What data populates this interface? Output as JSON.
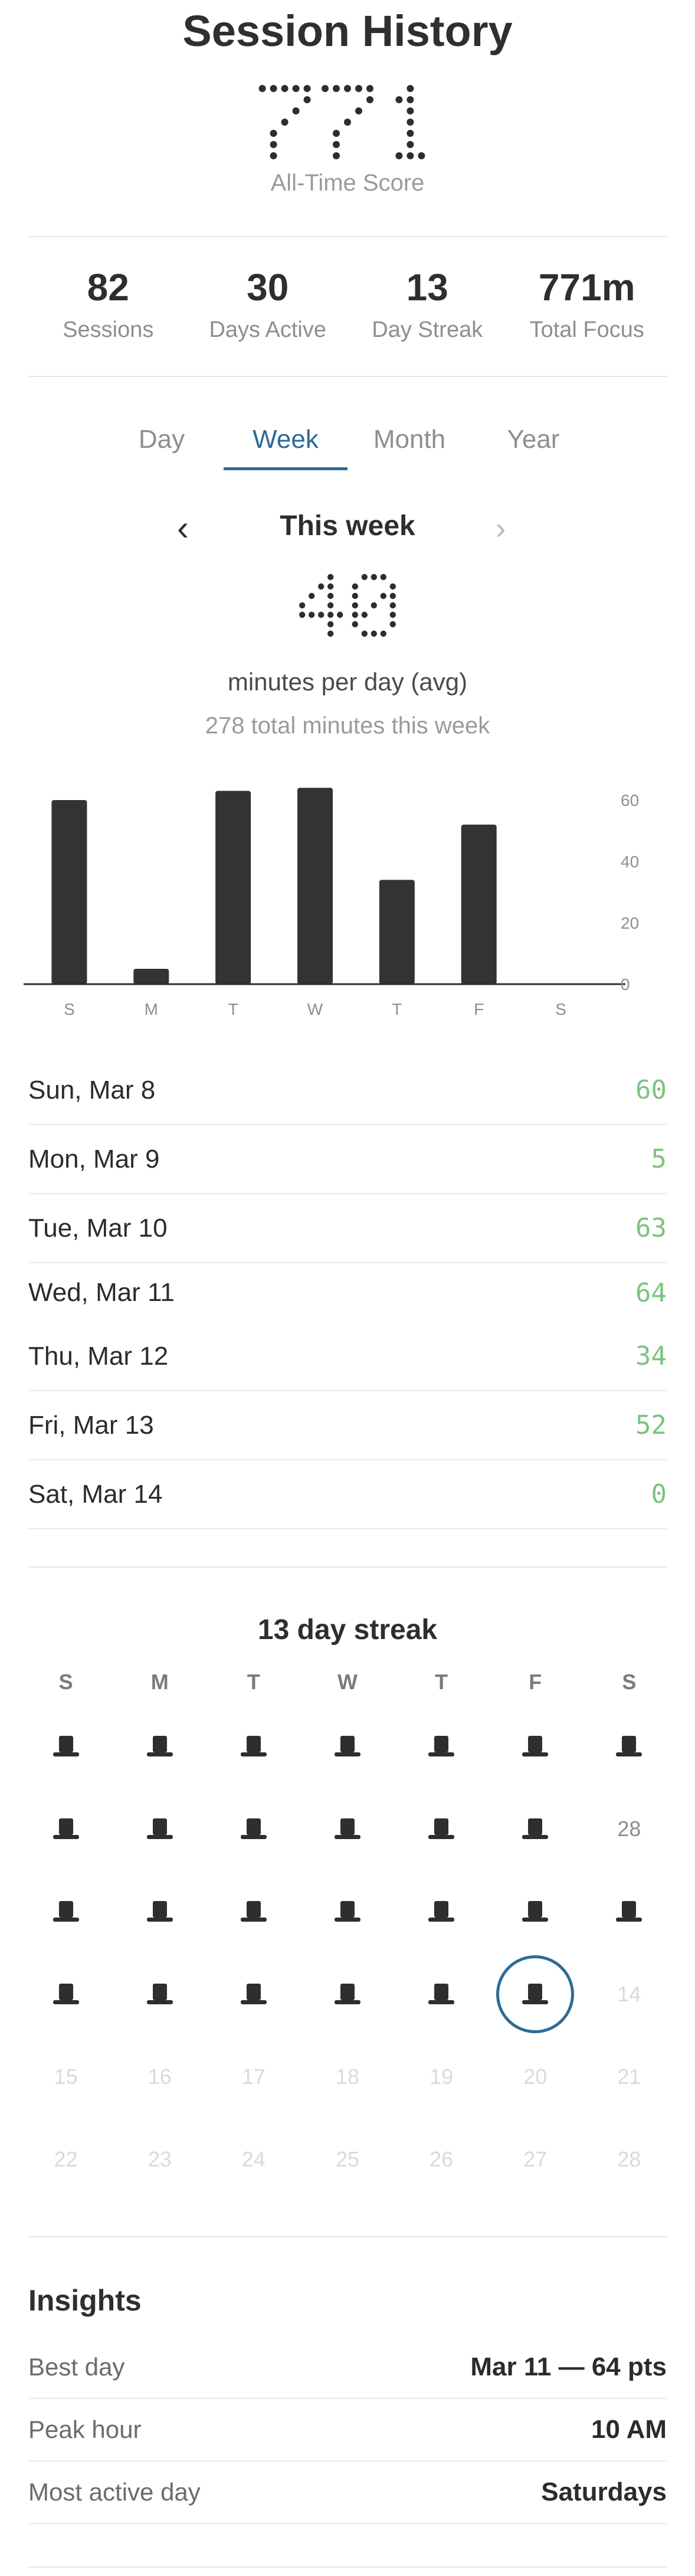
{
  "header": {
    "title": "Session History",
    "score": "771",
    "score_label": "All-Time Score"
  },
  "stats": [
    {
      "value": "82",
      "label": "Sessions"
    },
    {
      "value": "30",
      "label": "Days Active"
    },
    {
      "value": "13",
      "label": "Day Streak"
    },
    {
      "value": "771m",
      "label": "Total Focus"
    }
  ],
  "tabs": [
    {
      "label": "Day",
      "active": false
    },
    {
      "label": "Week",
      "active": true
    },
    {
      "label": "Month",
      "active": false
    },
    {
      "label": "Year",
      "active": false
    }
  ],
  "week_nav": {
    "prev_icon": "chevron-left-icon",
    "next_icon": "chevron-right-icon",
    "prev_glyph": "‹",
    "next_glyph": "›",
    "title": "This week"
  },
  "summary": {
    "avg": "40",
    "avg_label": "minutes per day (avg)",
    "total_label": "278 total minutes this week"
  },
  "chart_data": {
    "type": "bar",
    "categories": [
      "S",
      "M",
      "T",
      "W",
      "T",
      "F",
      "S"
    ],
    "values": [
      60,
      5,
      63,
      64,
      34,
      52,
      0
    ],
    "ylim": [
      0,
      65
    ],
    "yticks": [
      0,
      20,
      40,
      60
    ],
    "grid": false,
    "bar_color": "#333333"
  },
  "days": [
    {
      "name": "Sun, Mar 8",
      "value": "60"
    },
    {
      "name": "Mon, Mar 9",
      "value": "5"
    },
    {
      "name": "Tue, Mar 10",
      "value": "63"
    },
    {
      "name": "Wed, Mar 11",
      "value": "64"
    },
    {
      "name": "Thu, Mar 12",
      "value": "34"
    },
    {
      "name": "Fri, Mar 13",
      "value": "52"
    },
    {
      "name": "Sat, Mar 14",
      "value": "0"
    }
  ],
  "streak": {
    "title": "13 day streak",
    "weekdays": [
      "S",
      "M",
      "T",
      "W",
      "T",
      "F",
      "S"
    ],
    "icon": "top-hat-icon",
    "weeks": [
      [
        {
          "hat": true
        },
        {
          "hat": true
        },
        {
          "hat": true
        },
        {
          "hat": true
        },
        {
          "hat": true
        },
        {
          "hat": true
        },
        {
          "hat": true
        }
      ],
      [
        {
          "hat": true
        },
        {
          "hat": true
        },
        {
          "hat": true
        },
        {
          "hat": true
        },
        {
          "hat": true
        },
        {
          "hat": true
        },
        {
          "text": "28",
          "style": "prev"
        }
      ],
      [
        {
          "hat": true
        },
        {
          "hat": true
        },
        {
          "hat": true
        },
        {
          "hat": true
        },
        {
          "hat": true
        },
        {
          "hat": true
        },
        {
          "hat": true
        }
      ],
      [
        {
          "hat": true
        },
        {
          "hat": true
        },
        {
          "hat": true
        },
        {
          "hat": true
        },
        {
          "hat": true
        },
        {
          "hat": true,
          "today": true
        },
        {
          "text": "14",
          "style": "future"
        }
      ],
      [
        {
          "text": "15"
        },
        {
          "text": "16"
        },
        {
          "text": "17"
        },
        {
          "text": "18"
        },
        {
          "text": "19"
        },
        {
          "text": "20"
        },
        {
          "text": "21"
        }
      ],
      [
        {
          "text": "22"
        },
        {
          "text": "23"
        },
        {
          "text": "24"
        },
        {
          "text": "25"
        },
        {
          "text": "26"
        },
        {
          "text": "27"
        },
        {
          "text": "28"
        }
      ]
    ],
    "today_color": "#2c6b96"
  },
  "insights": {
    "title": "Insights",
    "rows": [
      {
        "label": "Best day",
        "value": "Mar 11 — 64 pts"
      },
      {
        "label": "Peak hour",
        "value": "10 AM"
      },
      {
        "label": "Most active day",
        "value": "Saturdays"
      }
    ]
  },
  "colors": {
    "accent": "#2c6b96",
    "positive": "#7cc47e",
    "text": "#2b2b2b",
    "muted": "#8e8e8e"
  }
}
